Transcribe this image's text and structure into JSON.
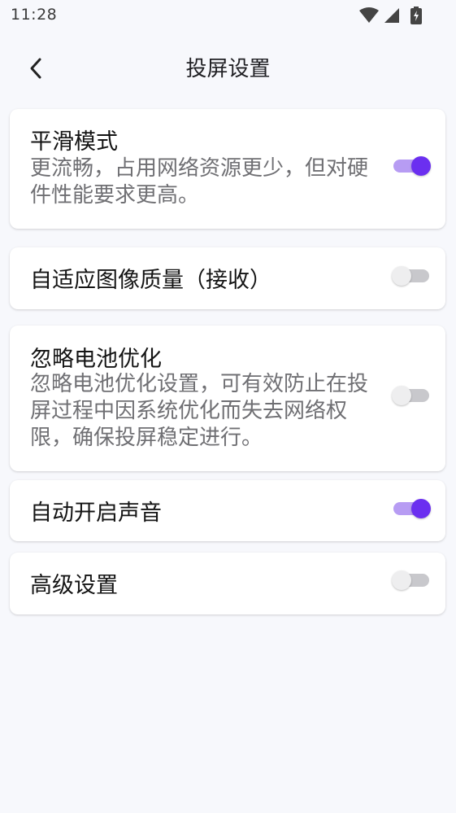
{
  "status_bar": {
    "time": "11:28",
    "icons": [
      "wifi-icon",
      "cellular-signal-icon",
      "battery-charging-icon"
    ]
  },
  "header": {
    "back_icon": "chevron-left-icon",
    "title": "投屏设置"
  },
  "colors": {
    "accent": "#6b2ff0",
    "accent_track": "#b79cf3",
    "background": "#f7f8fc"
  },
  "settings": [
    {
      "title": "平滑模式",
      "description": "更流畅，占用网络资源更少，但对硬件性能要求更高。",
      "enabled": true
    },
    {
      "title": "自适应图像质量（接收）",
      "description": "",
      "enabled": false
    },
    {
      "title": "忽略电池优化",
      "description": "忽略电池优化设置，可有效防止在投屏过程中因系统优化而失去网络权限，确保投屏稳定进行。",
      "enabled": false
    },
    {
      "title": "自动开启声音",
      "description": "",
      "enabled": true
    },
    {
      "title": "高级设置",
      "description": "",
      "enabled": false
    }
  ]
}
